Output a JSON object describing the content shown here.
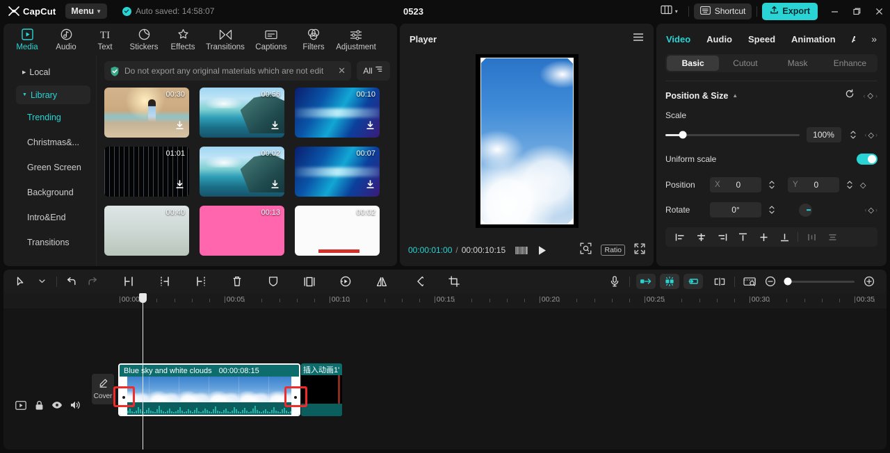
{
  "titlebar": {
    "brand": "CapCut",
    "menu_label": "Menu",
    "autosave_text": "Auto saved: 14:58:07",
    "project_title": "0523",
    "shortcut_label": "Shortcut",
    "export_label": "Export",
    "icons": {
      "layout": "layout-icon",
      "chevron": "chevron-down-icon",
      "minimize": "minimize-icon",
      "maximize": "restore-icon",
      "close": "close-icon"
    }
  },
  "media_panel": {
    "tabs": [
      {
        "label": "Media",
        "icon": "media-icon",
        "active": true
      },
      {
        "label": "Audio",
        "icon": "audio-icon",
        "active": false
      },
      {
        "label": "Text",
        "icon": "text-icon",
        "active": false
      },
      {
        "label": "Stickers",
        "icon": "stickers-icon",
        "active": false
      },
      {
        "label": "Effects",
        "icon": "effects-icon",
        "active": false
      },
      {
        "label": "Transitions",
        "icon": "transitions-icon",
        "active": false
      },
      {
        "label": "Captions",
        "icon": "captions-icon",
        "active": false
      },
      {
        "label": "Filters",
        "icon": "filters-icon",
        "active": false
      },
      {
        "label": "Adjustment",
        "icon": "adjustment-icon",
        "active": false
      }
    ],
    "categories": [
      {
        "label": "Local",
        "type": "group",
        "expanded": false,
        "selected": false
      },
      {
        "label": "Library",
        "type": "group",
        "expanded": true,
        "selected": true
      }
    ],
    "library_items": [
      {
        "label": "Trending",
        "active": true
      },
      {
        "label": "Christmas&...",
        "active": false
      },
      {
        "label": "Green Screen",
        "active": false
      },
      {
        "label": "Background",
        "active": false
      },
      {
        "label": "Intro&End",
        "active": false
      },
      {
        "label": "Transitions",
        "active": false
      }
    ],
    "notice": {
      "text": "Do not export any original materials which are not edit",
      "close_icon": "close-icon",
      "shield_icon": "shield-check-icon"
    },
    "filter_button": {
      "label": "All",
      "icon": "filter-icon"
    },
    "media_items": [
      {
        "duration": "00:30",
        "thumb": "th-beach",
        "download": true
      },
      {
        "duration": "00:56",
        "thumb": "th-island",
        "download": true
      },
      {
        "duration": "00:10",
        "thumb": "th-particles",
        "download": true
      },
      {
        "duration": "01:01",
        "thumb": "th-rain",
        "download": true
      },
      {
        "duration": "00:02",
        "thumb": "th-island",
        "download": true
      },
      {
        "duration": "00:07",
        "thumb": "th-particles",
        "download": true
      },
      {
        "duration": "00:40",
        "thumb": "th-grass",
        "download": false
      },
      {
        "duration": "00:13",
        "thumb": "th-pink",
        "download": false
      },
      {
        "duration": "00:02",
        "thumb": "th-white",
        "download": false
      }
    ]
  },
  "player": {
    "title": "Player",
    "menu_icon": "hamburger-icon",
    "current_time": "00:00:01:00",
    "separator": "/",
    "total_time": "00:00:10:15",
    "play_icon": "play-icon",
    "frames_icon": "frames-icon",
    "zoom_fit_icon": "zoom-fit-icon",
    "ratio_label": "Ratio",
    "fullscreen_icon": "fullscreen-icon"
  },
  "properties": {
    "tabs": [
      {
        "label": "Video",
        "active": true
      },
      {
        "label": "Audio",
        "active": false
      },
      {
        "label": "Speed",
        "active": false
      },
      {
        "label": "Animation",
        "active": false
      },
      {
        "label": "A",
        "active": false
      }
    ],
    "more_icon": "chevron-right-double-icon",
    "segments": [
      {
        "label": "Basic",
        "active": true
      },
      {
        "label": "Cutout",
        "active": false
      },
      {
        "label": "Mask",
        "active": false
      },
      {
        "label": "Enhance",
        "active": false
      }
    ],
    "section": {
      "title": "Position & Size",
      "reset_icon": "reset-icon",
      "keyframe_icon": "keyframe-diamond-icon"
    },
    "scale": {
      "label": "Scale",
      "value": "100%",
      "slider_pct": 13
    },
    "uniform_scale": {
      "label": "Uniform scale",
      "enabled": true
    },
    "position": {
      "label": "Position",
      "x_label": "X",
      "x_value": "0",
      "y_label": "Y",
      "y_value": "0"
    },
    "rotate": {
      "label": "Rotate",
      "value": "0°"
    },
    "align_buttons": [
      "align-left-icon",
      "align-center-horizontal-icon",
      "align-right-icon",
      "align-top-icon",
      "align-middle-vertical-icon",
      "align-bottom-icon",
      "distribute-horizontal-icon",
      "distribute-vertical-icon"
    ]
  },
  "timeline": {
    "toolbar_left": [
      "select-arrow-icon",
      "chevron-down-icon",
      "undo-icon",
      "redo-icon",
      "split-icon",
      "trim-left-icon",
      "trim-right-icon",
      "delete-icon",
      "freeze-icon",
      "mirror-panel-icon",
      "speed-icon",
      "flip-icon",
      "rotate-icon",
      "crop-icon"
    ],
    "toolbar_right": [
      "microphone-icon",
      "snap-left-icon",
      "auto-snap-icon",
      "snap-right-icon",
      "link-icon",
      "preview-thumb-icon",
      "zoom-out-icon",
      "zoom-slider",
      "zoom-in-icon"
    ],
    "ruler_labels": [
      "00:00",
      "00:05",
      "00:10",
      "00:15",
      "00:20",
      "00:25",
      "00:30",
      "00:35"
    ],
    "track_controls": [
      "track-type-icon",
      "lock-icon",
      "eye-icon",
      "volume-icon"
    ],
    "cover_button": {
      "label": "Cover",
      "icon": "pencil-icon"
    },
    "clips": [
      {
        "name": "Blue sky and white clouds",
        "duration": "00:00:08:15",
        "selected": true,
        "trim_left_highlighted": true,
        "trim_right_highlighted": true
      },
      {
        "name": "插入动画1'",
        "duration": "",
        "selected": false
      }
    ],
    "playhead_position": "00:00:01:00"
  },
  "colors": {
    "accent": "#2ad4d4",
    "clip_teal": "#0d6d6d",
    "highlight_red": "#ef2b2b",
    "panel_bg": "#1c1c1c",
    "app_bg": "#0d0d0d"
  }
}
